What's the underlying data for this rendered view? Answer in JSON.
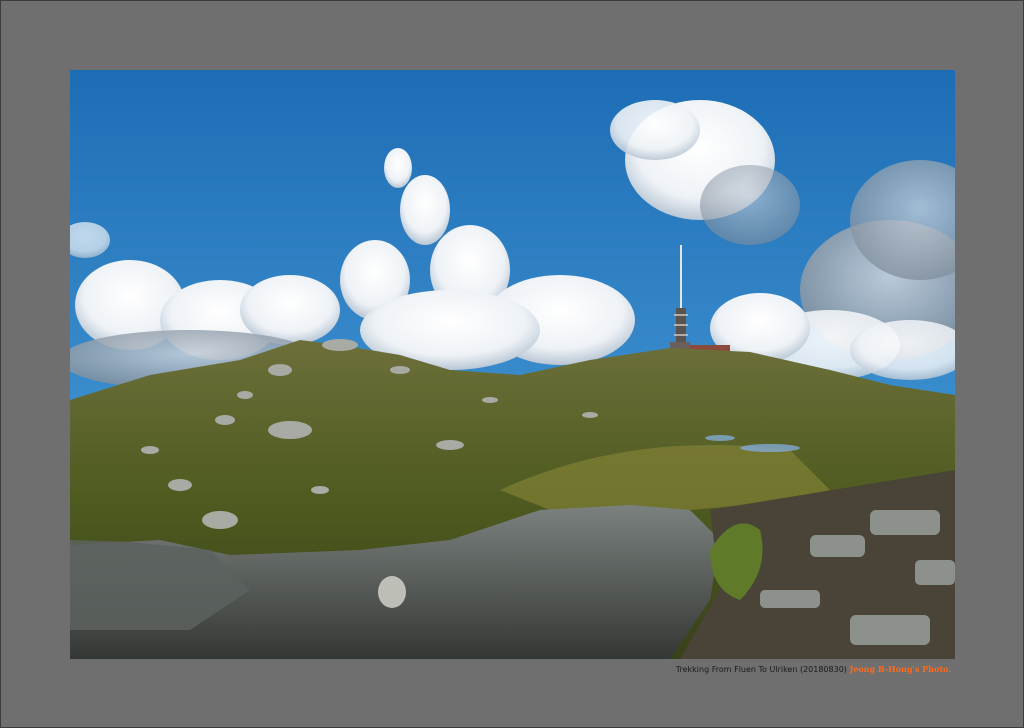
{
  "photo": {
    "subject": "mountain-landscape-with-radio-tower",
    "caption_title": "Trekking From Fluen To Ulriken (20180830)",
    "photo_credit": "Jeong B-Hong's Photo."
  },
  "colors": {
    "frame_gray": "#6f6f6f",
    "credit_orange": "#ff6a1a",
    "sky_blue": "#2f7fc0"
  }
}
